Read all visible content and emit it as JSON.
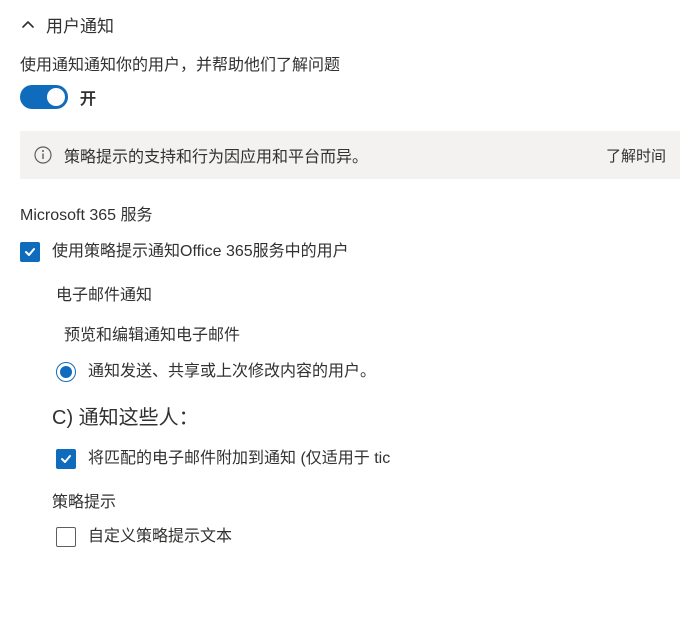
{
  "section": {
    "title": "用户通知"
  },
  "description": "使用通知通知你的用户，并帮助他们了解问题",
  "toggle": {
    "state_label": "开",
    "on": true
  },
  "banner": {
    "text": "策略提示的支持和行为因应用和平台而异。",
    "link": "了解时间"
  },
  "service_heading": "Microsoft 365 服务",
  "checkbox_policy_tip": {
    "checked": true,
    "label": "使用策略提示通知Office 365服务中的用户"
  },
  "email_heading": "电子邮件通知",
  "email_preview": "预览和编辑通知电子邮件",
  "radio_notify": {
    "selected": true,
    "label": "通知发送、共享或上次修改内容的用户。"
  },
  "group_c_heading": "C) 通知这些人：",
  "checkbox_attach": {
    "checked": true,
    "label": "将匹配的电子邮件附加到通知 (仅适用于 tic"
  },
  "policy_tip_heading": "策略提示",
  "checkbox_custom": {
    "checked": false,
    "label": "自定义策略提示文本"
  }
}
